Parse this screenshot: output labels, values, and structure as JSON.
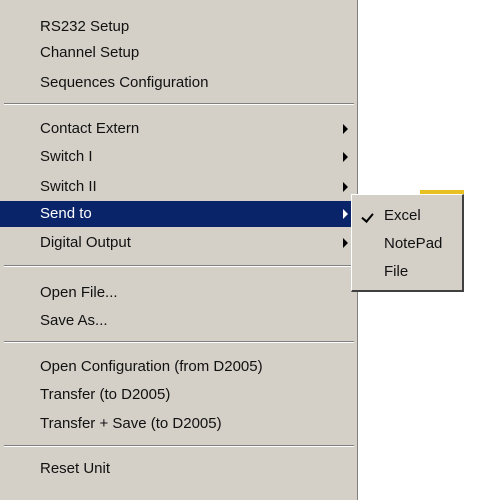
{
  "menu": {
    "items": [
      {
        "label": "RS232 Setup"
      },
      {
        "label": "Channel Setup"
      },
      {
        "label": "Sequences Configuration"
      },
      {
        "label": "Contact Extern"
      },
      {
        "label": "Switch I"
      },
      {
        "label": "Switch II"
      },
      {
        "label": "Send to"
      },
      {
        "label": "Digital Output"
      },
      {
        "label": "Open File..."
      },
      {
        "label": "Save As..."
      },
      {
        "label": "Open Configuration (from D2005)"
      },
      {
        "label": "Transfer (to D2005)"
      },
      {
        "label": "Transfer + Save (to D2005)"
      },
      {
        "label": "Reset Unit"
      }
    ],
    "highlight_color": "#0a246a"
  },
  "submenu": {
    "items": [
      {
        "label": "Excel",
        "checked": true
      },
      {
        "label": "NotePad"
      },
      {
        "label": "File"
      }
    ]
  }
}
